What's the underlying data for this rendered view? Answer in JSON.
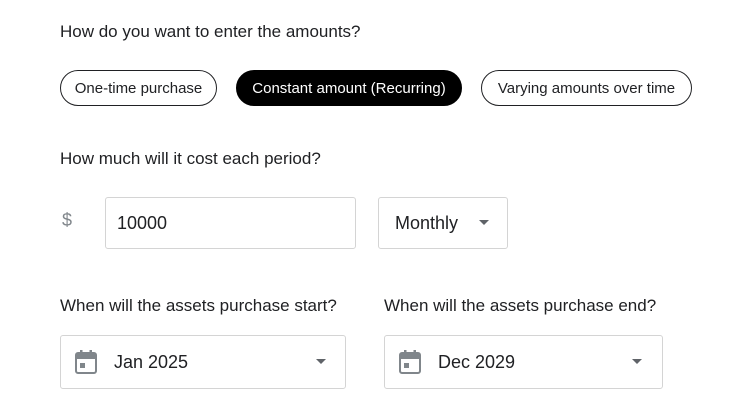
{
  "questions": {
    "entry_method": "How do you want to enter the amounts?",
    "cost_per_period": "How much will it cost each period?",
    "start": "When will the assets purchase start?",
    "end": "When will the assets purchase end?"
  },
  "options": {
    "one_time": "One-time purchase",
    "constant": "Constant amount (Recurring)",
    "varying": "Varying amounts over time",
    "selected": "constant"
  },
  "amount": {
    "currency_symbol": "$",
    "value": "10000"
  },
  "period": {
    "selected": "Monthly"
  },
  "start_date": {
    "value": "Jan 2025",
    "icon": "calendar-icon"
  },
  "end_date": {
    "value": "Dec 2029",
    "icon": "calendar-icon"
  },
  "colors": {
    "accent": "#000000",
    "border": "#d4d4d4",
    "text": "#202124",
    "icon": "#80868b"
  }
}
